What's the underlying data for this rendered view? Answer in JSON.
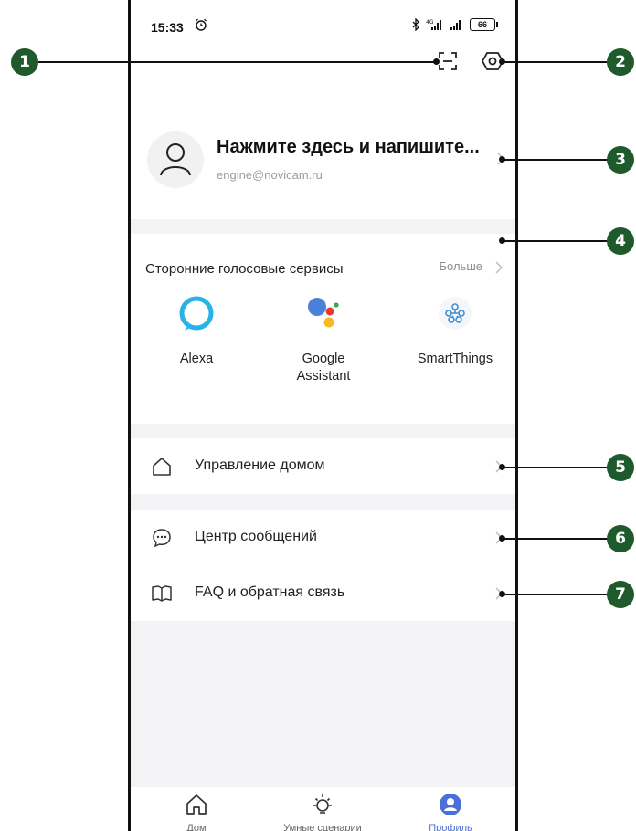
{
  "status_bar": {
    "time": "15:33",
    "battery": "66"
  },
  "profile": {
    "name": "Нажмите здесь и напишите...",
    "email": "engine@novicam.ru"
  },
  "voice_services": {
    "title": "Сторонние голосовые сервисы",
    "more_label": "Больше",
    "items": [
      {
        "label_line1": "Alexa",
        "label_line2": "",
        "icon": "alexa-icon"
      },
      {
        "label_line1": "Google",
        "label_line2": "Assistant",
        "icon": "google-assistant-icon"
      },
      {
        "label_line1": "SmartThings",
        "label_line2": "",
        "icon": "smartthings-icon"
      }
    ]
  },
  "menu": {
    "home_management": "Управление домом",
    "message_center": "Центр сообщений",
    "faq_feedback": "FAQ и обратная связь"
  },
  "bottom_nav": [
    {
      "label": "Дом",
      "icon": "home-icon"
    },
    {
      "label": "Умные сценарии",
      "icon": "sun-icon"
    },
    {
      "label": "Профиль",
      "icon": "profile-icon",
      "active": true
    }
  ],
  "callouts": [
    "1",
    "2",
    "3",
    "4",
    "5",
    "6",
    "7"
  ],
  "colors": {
    "badge": "#1e5a2c",
    "accent": "#4a6fd8",
    "section_gap": "#f3f3f5"
  }
}
